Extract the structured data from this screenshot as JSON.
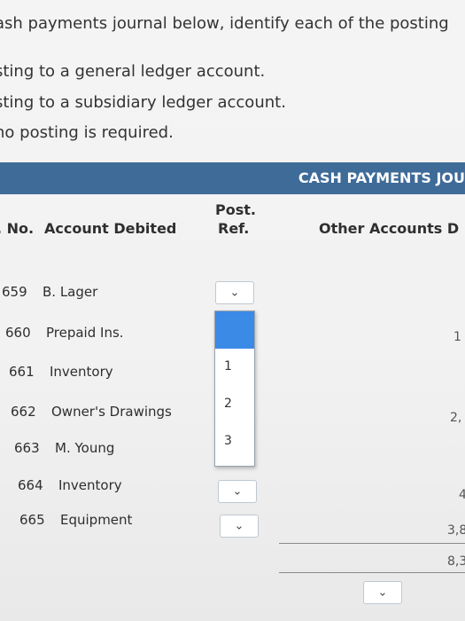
{
  "instructions": {
    "line1": "ash payments journal below, identify each of the posting",
    "line2": "sting to a general ledger account.",
    "line3": "sting to a subsidiary ledger account.",
    "line4": " no posting is required."
  },
  "journal": {
    "title": "CASH PAYMENTS JOU",
    "headers": {
      "ck_no": ". No.",
      "account": "Account Debited",
      "post_ref_1": "Post.",
      "post_ref_2": "Ref.",
      "other": "Other Accounts D"
    },
    "rows": [
      {
        "no": "659",
        "account": "B. Lager"
      },
      {
        "no": "660",
        "account": "Prepaid Ins."
      },
      {
        "no": "661",
        "account": "Inventory"
      },
      {
        "no": "662",
        "account": "Owner's Drawings"
      },
      {
        "no": "663",
        "account": "M. Young"
      },
      {
        "no": "664",
        "account": "Inventory"
      },
      {
        "no": "665",
        "account": "Equipment"
      }
    ],
    "dropdown_options": [
      "",
      "1",
      "2",
      "3"
    ],
    "other_amounts": [
      "1",
      "2,",
      "4",
      "3,8",
      "8,3"
    ]
  },
  "icons": {
    "chevron": "chevron-down-icon"
  }
}
